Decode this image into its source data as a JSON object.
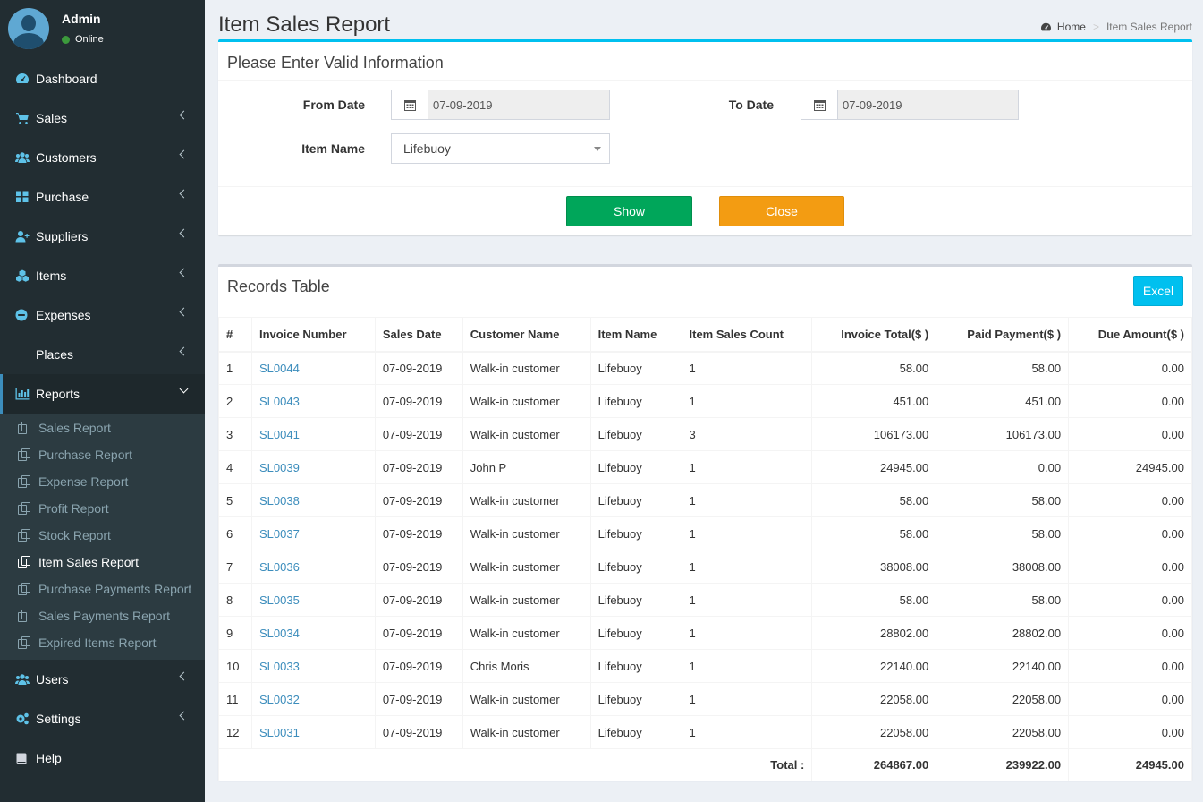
{
  "user": {
    "name": "Admin",
    "status": "Online"
  },
  "sidebar": {
    "items": [
      {
        "label": "Dashboard",
        "icon": "dashboard-icon"
      },
      {
        "label": "Sales",
        "icon": "cart-icon"
      },
      {
        "label": "Customers",
        "icon": "users-icon"
      },
      {
        "label": "Purchase",
        "icon": "grid-icon"
      },
      {
        "label": "Suppliers",
        "icon": "user-plus-icon"
      },
      {
        "label": "Items",
        "icon": "cubes-icon"
      },
      {
        "label": "Expenses",
        "icon": "minus-circle-icon"
      },
      {
        "label": "Places",
        "icon": "map-icon"
      },
      {
        "label": "Reports",
        "icon": "bar-chart-icon"
      }
    ],
    "reports_sub": [
      "Sales Report",
      "Purchase Report",
      "Expense Report",
      "Profit Report",
      "Stock Report",
      "Item Sales Report",
      "Purchase Payments Report",
      "Sales Payments Report",
      "Expired Items Report"
    ],
    "bottom_items": [
      {
        "label": "Users",
        "icon": "users-icon"
      },
      {
        "label": "Settings",
        "icon": "cogs-icon"
      },
      {
        "label": "Help",
        "icon": "book-icon"
      }
    ]
  },
  "header": {
    "title": "Item Sales Report",
    "breadcrumb_home": "Home",
    "breadcrumb_current": "Item Sales Report"
  },
  "form": {
    "title": "Please Enter Valid Information",
    "from_date_label": "From Date",
    "from_date_value": "07-09-2019",
    "to_date_label": "To Date",
    "to_date_value": "07-09-2019",
    "item_name_label": "Item Name",
    "item_name_value": "Lifebuoy",
    "show_label": "Show",
    "close_label": "Close"
  },
  "records": {
    "title": "Records Table",
    "excel_label": "Excel",
    "columns": [
      "#",
      "Invoice Number",
      "Sales Date",
      "Customer Name",
      "Item Name",
      "Item Sales Count",
      "Invoice Total($ )",
      "Paid Payment($ )",
      "Due Amount($ )"
    ],
    "rows": [
      [
        "1",
        "SL0044",
        "07-09-2019",
        "Walk-in customer",
        "Lifebuoy",
        "1",
        "58.00",
        "58.00",
        "0.00"
      ],
      [
        "2",
        "SL0043",
        "07-09-2019",
        "Walk-in customer",
        "Lifebuoy",
        "1",
        "451.00",
        "451.00",
        "0.00"
      ],
      [
        "3",
        "SL0041",
        "07-09-2019",
        "Walk-in customer",
        "Lifebuoy",
        "3",
        "106173.00",
        "106173.00",
        "0.00"
      ],
      [
        "4",
        "SL0039",
        "07-09-2019",
        "John P",
        "Lifebuoy",
        "1",
        "24945.00",
        "0.00",
        "24945.00"
      ],
      [
        "5",
        "SL0038",
        "07-09-2019",
        "Walk-in customer",
        "Lifebuoy",
        "1",
        "58.00",
        "58.00",
        "0.00"
      ],
      [
        "6",
        "SL0037",
        "07-09-2019",
        "Walk-in customer",
        "Lifebuoy",
        "1",
        "58.00",
        "58.00",
        "0.00"
      ],
      [
        "7",
        "SL0036",
        "07-09-2019",
        "Walk-in customer",
        "Lifebuoy",
        "1",
        "38008.00",
        "38008.00",
        "0.00"
      ],
      [
        "8",
        "SL0035",
        "07-09-2019",
        "Walk-in customer",
        "Lifebuoy",
        "1",
        "58.00",
        "58.00",
        "0.00"
      ],
      [
        "9",
        "SL0034",
        "07-09-2019",
        "Walk-in customer",
        "Lifebuoy",
        "1",
        "28802.00",
        "28802.00",
        "0.00"
      ],
      [
        "10",
        "SL0033",
        "07-09-2019",
        "Chris Moris",
        "Lifebuoy",
        "1",
        "22140.00",
        "22140.00",
        "0.00"
      ],
      [
        "11",
        "SL0032",
        "07-09-2019",
        "Walk-in customer",
        "Lifebuoy",
        "1",
        "22058.00",
        "22058.00",
        "0.00"
      ],
      [
        "12",
        "SL0031",
        "07-09-2019",
        "Walk-in customer",
        "Lifebuoy",
        "1",
        "22058.00",
        "22058.00",
        "0.00"
      ]
    ],
    "total_label": "Total :",
    "total_invoice": "264867.00",
    "total_paid": "239922.00",
    "total_due": "24945.00"
  },
  "colors": {
    "sidebar_bg": "#222d32",
    "accent": "#3c8dbc",
    "show_button": "#00a65a",
    "close_button": "#f39c12",
    "excel_button": "#00c0ef"
  }
}
